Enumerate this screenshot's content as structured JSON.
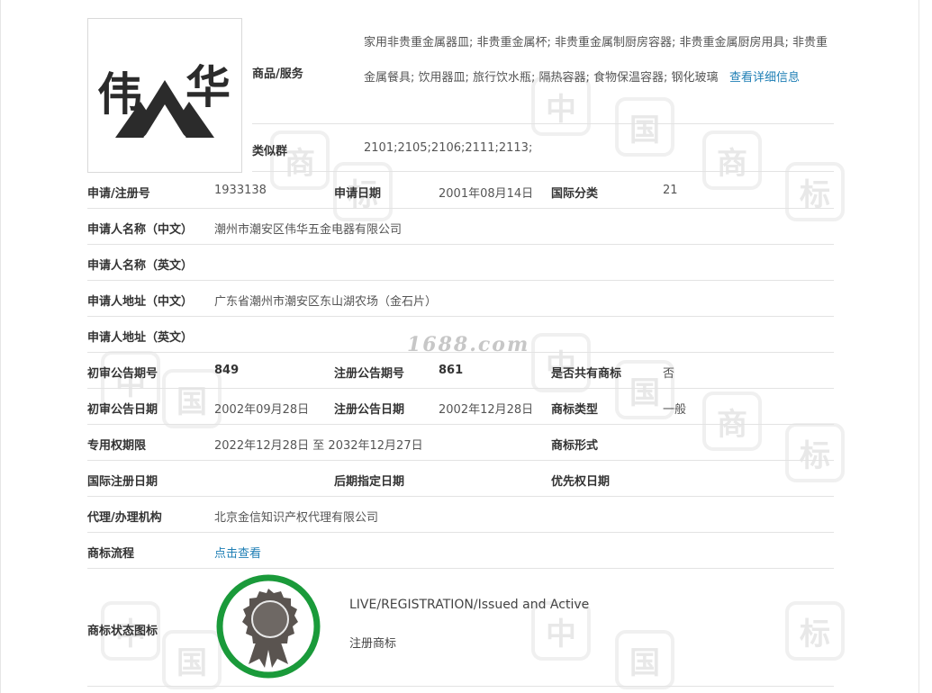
{
  "goods": {
    "label": "商品/服务",
    "text": "家用非贵重金属器皿; 非贵重金属杯; 非贵重金属制厨房容器; 非贵重金属厨房用具; 非贵重金属餐具; 饮用器皿; 旅行饮水瓶; 隔热容器; 食物保温容器; 钢化玻璃",
    "detail_link": "查看详细信息"
  },
  "similar_group": {
    "label": "类似群",
    "value": "2101;2105;2106;2111;2113;"
  },
  "logo": {
    "chars": [
      "伟",
      "华"
    ],
    "brand_colors": {
      "ink": "#2b2b2b"
    }
  },
  "fields": {
    "reg_no_label": "申请/注册号",
    "reg_no": "1933138",
    "apply_date_label": "申请日期",
    "apply_date": "2001年08月14日",
    "intl_class_label": "国际分类",
    "intl_class": "21",
    "applicant_cn_label": "申请人名称（中文）",
    "applicant_cn": "潮州市潮安区伟华五金电器有限公司",
    "applicant_en_label": "申请人名称（英文）",
    "applicant_en": "",
    "address_cn_label": "申请人地址（中文）",
    "address_cn": "广东省潮州市潮安区东山湖农场（金石片）",
    "address_en_label": "申请人地址（英文）",
    "address_en": "",
    "prelim_no_label": "初审公告期号",
    "prelim_no": "849",
    "reg_notice_no_label": "注册公告期号",
    "reg_notice_no": "861",
    "shared_label": "是否共有商标",
    "shared": "否",
    "prelim_date_label": "初审公告日期",
    "prelim_date": "2002年09月28日",
    "reg_notice_date_label": "注册公告日期",
    "reg_notice_date": "2002年12月28日",
    "mark_type_label": "商标类型",
    "mark_type": "一般",
    "exclusive_label": "专用权期限",
    "exclusive": "2022年12月28日 至 2032年12月27日",
    "mark_form_label": "商标形式",
    "mark_form": "",
    "intl_reg_date_label": "国际注册日期",
    "intl_reg_date": "",
    "later_designation_label": "后期指定日期",
    "later_designation": "",
    "priority_date_label": "优先权日期",
    "priority_date": "",
    "agency_label": "代理/办理机构",
    "agency": "北京金信知识产权代理有限公司",
    "process_label": "商标流程",
    "process_link": "点击查看",
    "status_icon_label": "商标状态图标"
  },
  "status": {
    "en": "LIVE/REGISTRATION/Issued and Active",
    "cn": "注册商标",
    "ring_color": "#1a9a3a",
    "medal_color": "#5a5450"
  },
  "watermark": {
    "site": "1688.com",
    "chars": [
      "中",
      "国",
      "商",
      "标"
    ]
  }
}
